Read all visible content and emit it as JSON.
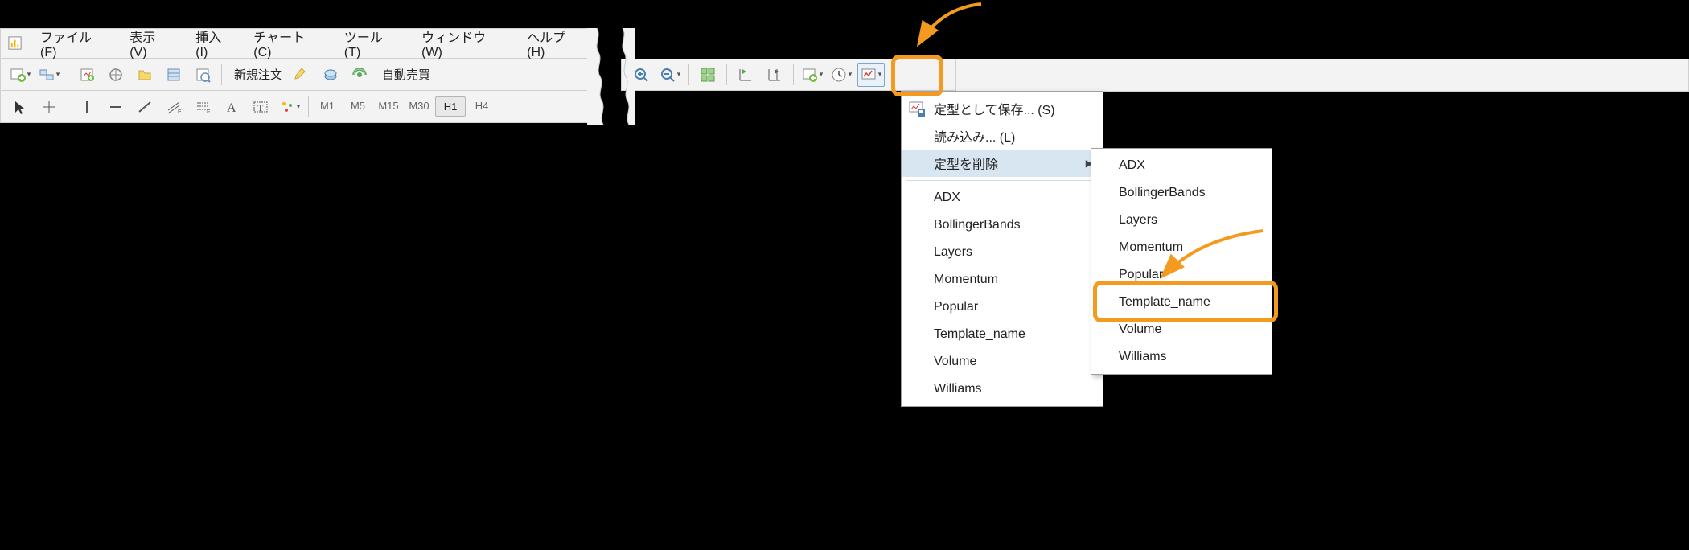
{
  "menu_bar": {
    "items": [
      "ファイル (F)",
      "表示 (V)",
      "挿入(I)",
      "チャート (C)",
      "ツール (T)",
      "ウィンドウ (W)",
      "ヘルプ (H)"
    ]
  },
  "toolbar1": {
    "new_order": "新規注文",
    "autotrade": "自動売買"
  },
  "timeframes": [
    "M1",
    "M5",
    "M15",
    "M30",
    "H1",
    "H4"
  ],
  "active_timeframe": "H1",
  "template_menu": {
    "save_as": "定型として保存... (S)",
    "load": "読み込み... (L)",
    "delete": "定型を削除",
    "list": [
      "ADX",
      "BollingerBands",
      "Layers",
      "Momentum",
      "Popular",
      "Template_name",
      "Volume",
      "Williams"
    ]
  },
  "delete_submenu": {
    "list": [
      "ADX",
      "BollingerBands",
      "Layers",
      "Momentum",
      "Popular",
      "Template_name",
      "Volume",
      "Williams"
    ],
    "highlighted": "Template_name"
  },
  "icons": {
    "app": "app-icon",
    "template": "template-chart-icon",
    "saveas": "save-template-icon"
  }
}
